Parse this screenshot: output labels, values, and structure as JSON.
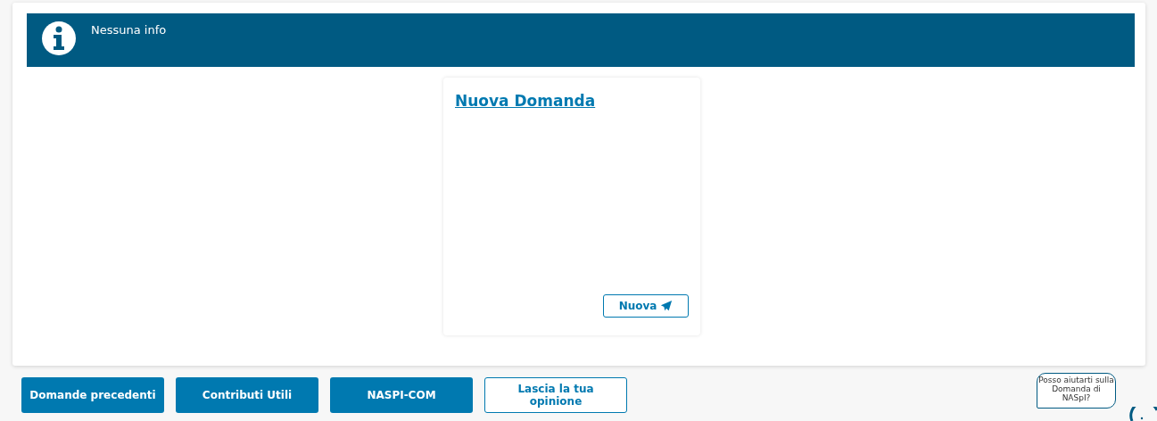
{
  "info_banner": {
    "message": "Nessuna info"
  },
  "card": {
    "title": "Nuova Domanda",
    "button": "Nuova"
  },
  "buttons": [
    {
      "label": "Domande precedenti",
      "kind": "primary"
    },
    {
      "label": "Contributi Utili",
      "kind": "primary"
    },
    {
      "label": "NASPI-COM",
      "kind": "primary"
    },
    {
      "label": "Lascia la tua opinione",
      "kind": "outline"
    }
  ],
  "chat_bubble": {
    "text": "Posso aiutarti sulla Domanda di NASpI?"
  }
}
